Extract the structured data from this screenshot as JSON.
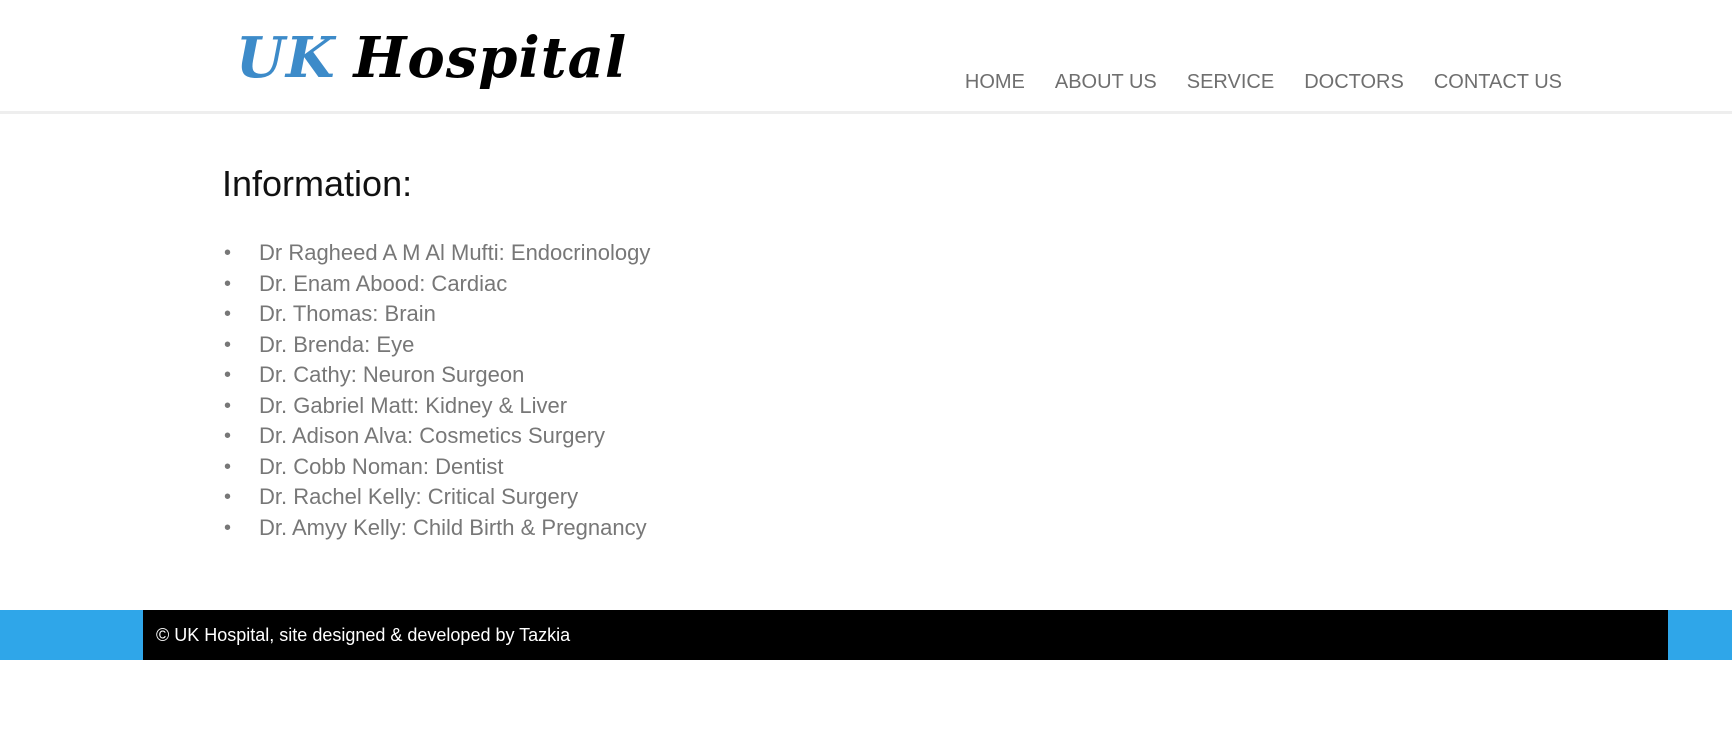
{
  "logo": {
    "part1": "UK",
    "part2": "Hospital",
    "accent_color": "#3d8bc9"
  },
  "nav": {
    "items": [
      {
        "label": "HOME"
      },
      {
        "label": "ABOUT US"
      },
      {
        "label": "SERVICE"
      },
      {
        "label": "DOCTORS"
      },
      {
        "label": "CONTACT US"
      }
    ]
  },
  "main": {
    "title": "Information:",
    "bullet": "•",
    "doctors": [
      "Dr Ragheed A M Al Mufti: Endocrinology",
      "Dr. Enam Abood: Cardiac",
      "Dr. Thomas: Brain",
      "Dr. Brenda: Eye",
      "Dr. Cathy: Neuron Surgeon",
      "Dr. Gabriel Matt: Kidney & Liver",
      "Dr. Adison Alva: Cosmetics Surgery",
      "Dr. Cobb Noman: Dentist",
      "Dr. Rachel Kelly: Critical Surgery",
      "Dr. Amyy Kelly: Child Birth & Pregnancy"
    ]
  },
  "footer": {
    "text": "© UK Hospital, site designed & developed by Tazkia",
    "band_color": "#2fa6e9",
    "inner_color": "#000000"
  }
}
